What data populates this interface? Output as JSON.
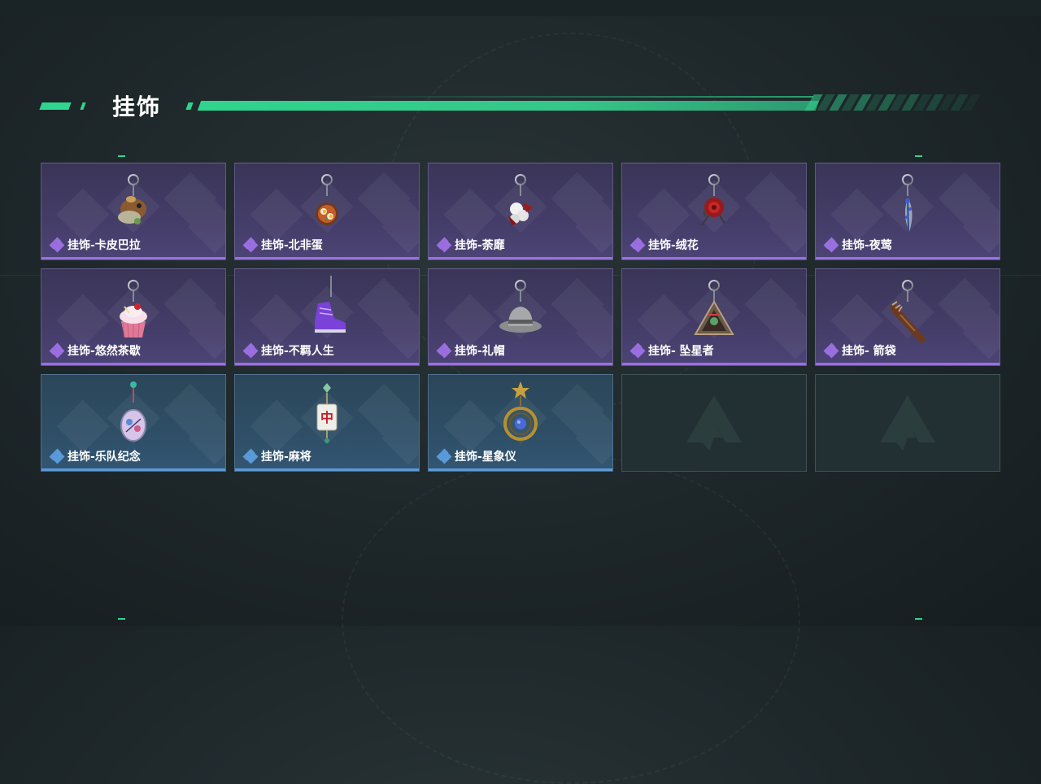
{
  "section": {
    "title": "挂饰"
  },
  "colors": {
    "accent": "#2fd48e",
    "epic": "#9b6ee0",
    "rare": "#5b9ad8"
  },
  "items": [
    {
      "name": "挂饰-卡皮巴拉",
      "rarity": "epic",
      "icon": "capybara-charm-icon"
    },
    {
      "name": "挂饰-北非蛋",
      "rarity": "epic",
      "icon": "shakshuka-charm-icon"
    },
    {
      "name": "挂饰-荼靡",
      "rarity": "epic",
      "icon": "flower-charm-icon"
    },
    {
      "name": "挂饰-绒花",
      "rarity": "epic",
      "icon": "rose-charm-icon"
    },
    {
      "name": "挂饰-夜莺",
      "rarity": "epic",
      "icon": "feather-charm-icon"
    },
    {
      "name": "挂饰-悠然茶歇",
      "rarity": "epic",
      "icon": "cupcake-charm-icon"
    },
    {
      "name": "挂饰-不羁人生",
      "rarity": "epic",
      "icon": "sneaker-charm-icon"
    },
    {
      "name": "挂饰-礼帽",
      "rarity": "epic",
      "icon": "hat-charm-icon"
    },
    {
      "name": "挂饰- 坠星者",
      "rarity": "epic",
      "icon": "triangle-emblem-charm-icon"
    },
    {
      "name": "挂饰- 箭袋",
      "rarity": "epic",
      "icon": "quiver-charm-icon"
    },
    {
      "name": "挂饰-乐队纪念",
      "rarity": "rare",
      "icon": "band-badge-charm-icon"
    },
    {
      "name": "挂饰-麻将",
      "rarity": "rare",
      "icon": "mahjong-charm-icon"
    },
    {
      "name": "挂饰-星象仪",
      "rarity": "rare",
      "icon": "astrolabe-charm-icon"
    },
    {
      "name": "",
      "rarity": "empty",
      "icon": "empty-slot-logo-icon"
    },
    {
      "name": "",
      "rarity": "empty",
      "icon": "empty-slot-logo-icon"
    }
  ]
}
